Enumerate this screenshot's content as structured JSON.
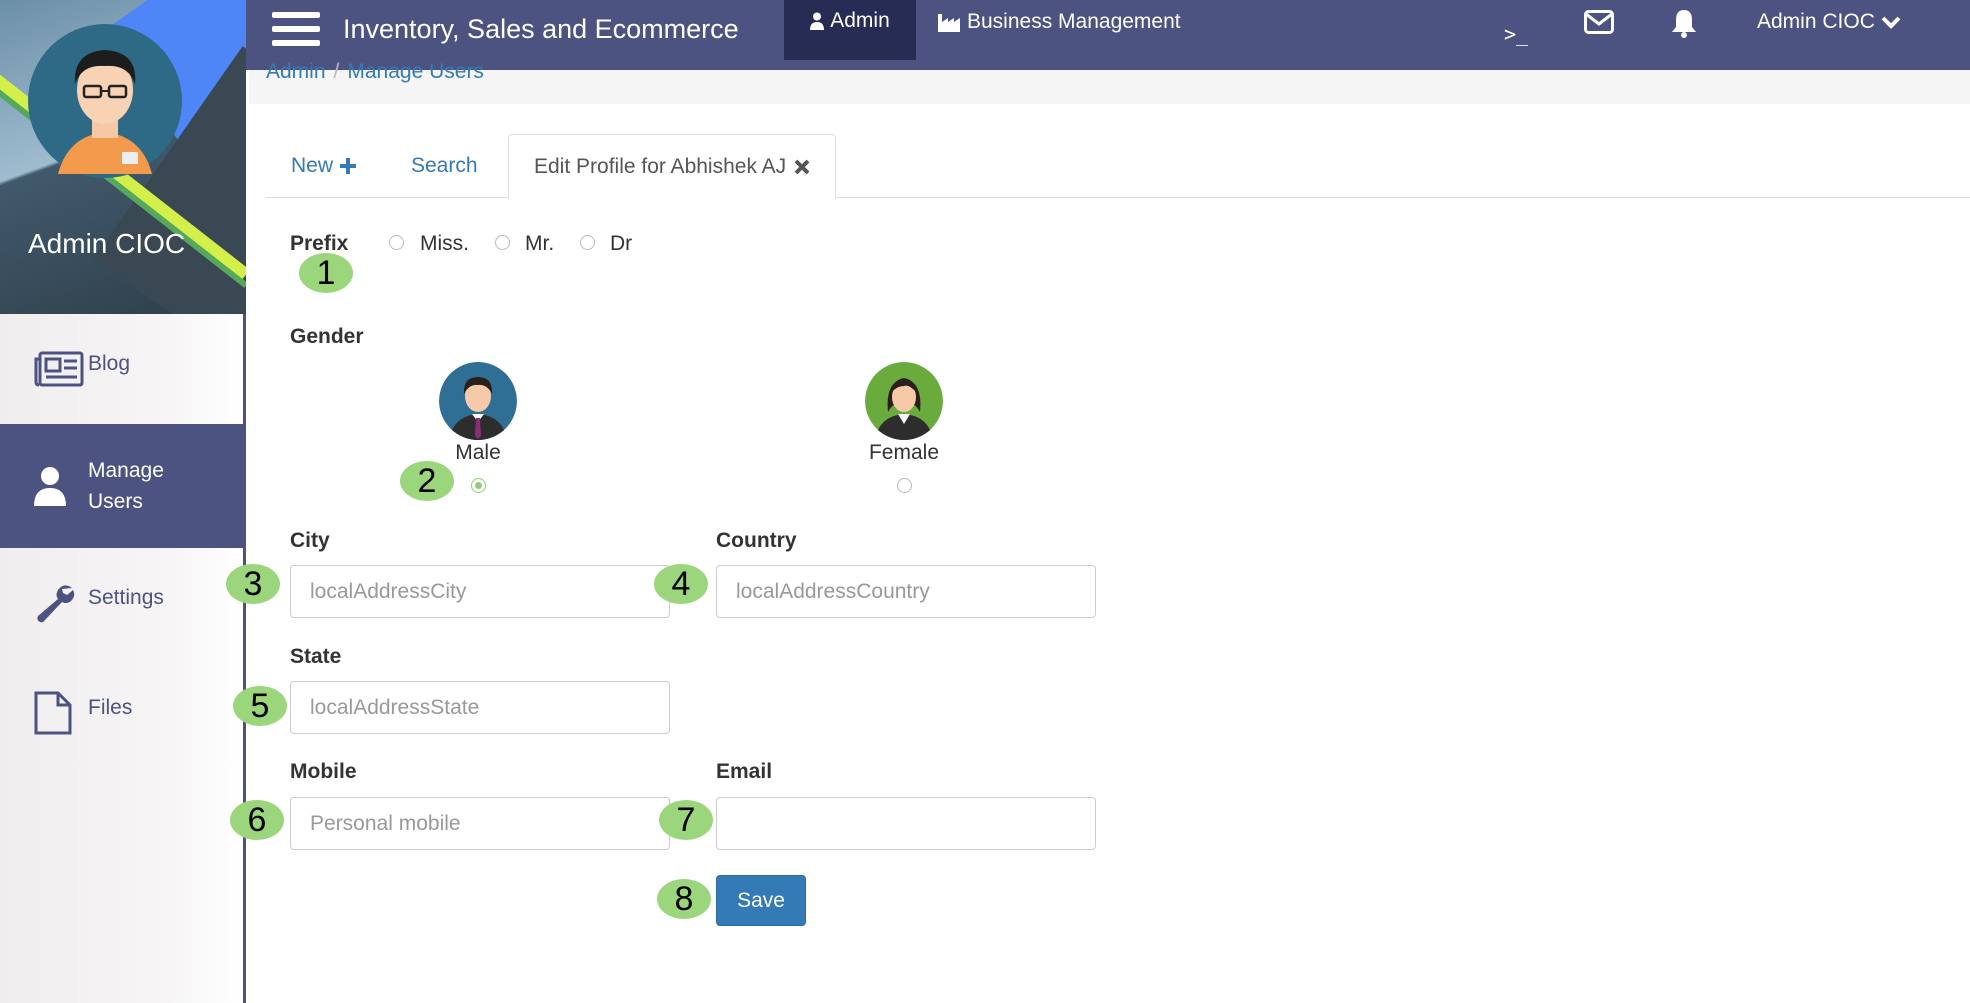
{
  "sidebar": {
    "user_name": "Admin CIOC",
    "items": [
      {
        "label": "Blog",
        "icon": "newspaper-icon"
      },
      {
        "label": "Manage Users",
        "icon": "user-icon"
      },
      {
        "label": "Settings",
        "icon": "wrench-icon"
      },
      {
        "label": "Files",
        "icon": "file-icon"
      }
    ]
  },
  "topbar": {
    "app_title": "Inventory, Sales and Ecommerce",
    "nav_admin": "Admin",
    "nav_business": "Business Management",
    "terminal_glyph": ">_",
    "user_menu": "Admin CIOC"
  },
  "breadcrumb": [
    "Admin",
    "Manage Users"
  ],
  "tabs": {
    "new": "New",
    "search": "Search",
    "edit": "Edit Profile for Abhishek AJ"
  },
  "form": {
    "prefix_label": "Prefix",
    "prefix_options": [
      "Miss.",
      "Mr.",
      "Dr"
    ],
    "gender_label": "Gender",
    "gender_male": "Male",
    "gender_female": "Female",
    "city_label": "City",
    "city_placeholder": "localAddressCity",
    "country_label": "Country",
    "country_placeholder": "localAddressCountry",
    "state_label": "State",
    "state_placeholder": "localAddressState",
    "mobile_label": "Mobile",
    "mobile_placeholder": "Personal mobile",
    "email_label": "Email",
    "email_value": "",
    "save_label": "Save"
  },
  "badges": [
    "1",
    "2",
    "3",
    "4",
    "5",
    "6",
    "7",
    "8"
  ],
  "colors": {
    "nav_bg": "#4d5381",
    "nav_active": "#272c55",
    "link": "#337ab7",
    "badge": "#9cd67c",
    "save": "#337ab7"
  }
}
